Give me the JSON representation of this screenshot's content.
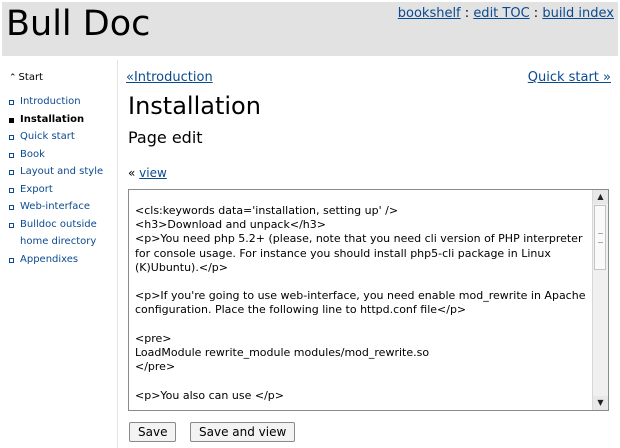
{
  "header": {
    "title": "Bull Doc",
    "nav": [
      {
        "label": "bookshelf"
      },
      {
        "label": "edit TOC"
      },
      {
        "label": "build index"
      }
    ],
    "separator": ":"
  },
  "sidebar": {
    "start_label": "Start",
    "items": [
      {
        "label": "Introduction",
        "current": false
      },
      {
        "label": "Installation",
        "current": true
      },
      {
        "label": "Quick start",
        "current": false
      },
      {
        "label": "Book",
        "current": false
      },
      {
        "label": "Layout and style",
        "current": false
      },
      {
        "label": "Export",
        "current": false
      },
      {
        "label": "Web-interface",
        "current": false
      },
      {
        "label": "Bulldoc outside home directory",
        "current": false
      },
      {
        "label": "Appendixes",
        "current": false
      }
    ]
  },
  "main": {
    "prev_link": "«Introduction",
    "next_link": "Quick start »",
    "title": "Installation",
    "subtitle": "Page edit",
    "view_prefix": "«",
    "view_link": "view",
    "editor_content": "<cls:keywords data='installation, setting up' />\n<h3>Download and unpack</h3>\n<p>You need php 5.2+ (please, note that you need cli version of PHP interpreter for console usage. For instance you should install php5-cli package in Linux (K)Ubuntu).</p>\n\n<p>If you're going to use web-interface, you need enable mod_rewrite in Apache configuration. Place the following line to httpd.conf file</p>\n\n<pre>\nLoadModule rewrite_module modules/mod_rewrite.so\n</pre>\n\n<p>You also can use </p>",
    "save_label": "Save",
    "save_view_label": "Save and view"
  },
  "icons": {
    "start_arrow": "double-up-chevron-icon",
    "scroll_up": "triangle-up-icon",
    "scroll_down": "triangle-down-icon"
  },
  "colors": {
    "header_bg": "#e2e2e2",
    "link": "#0b4a8f"
  }
}
